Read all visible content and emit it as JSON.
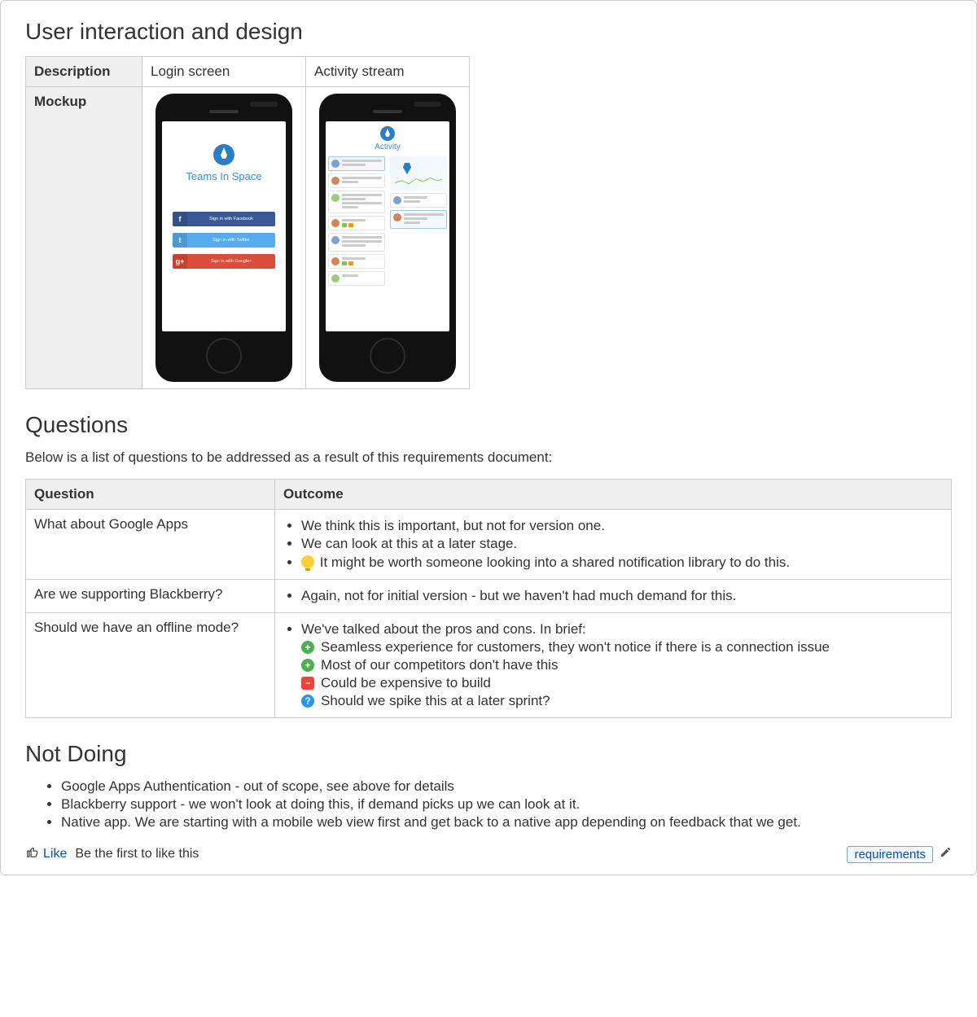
{
  "sections": {
    "design": {
      "heading": "User interaction and design",
      "row_labels": {
        "description": "Description",
        "mockup": "Mockup"
      },
      "columns": [
        {
          "title": "Login screen",
          "kind": "login"
        },
        {
          "title": "Activity stream",
          "kind": "activity"
        }
      ],
      "login_mock": {
        "app_name": "Teams In Space",
        "buttons": [
          {
            "provider": "facebook",
            "label": "Sign in with Facebook",
            "glyph": "f"
          },
          {
            "provider": "twitter",
            "label": "Sign in with Twitter",
            "glyph": "t"
          },
          {
            "provider": "google",
            "label": "Sign in with Google+",
            "glyph": "g+"
          }
        ]
      },
      "activity_mock": {
        "title": "Activity"
      }
    },
    "questions": {
      "heading": "Questions",
      "intro": "Below is a list of questions to be addressed as a result of this requirements document:",
      "columns": {
        "q": "Question",
        "o": "Outcome"
      },
      "rows": [
        {
          "q": "What about Google Apps",
          "outcomes": [
            {
              "text": "We think this is important, but not for version one."
            },
            {
              "text": "We can look at this at a later stage."
            },
            {
              "icon": "bulb",
              "text": "It might be worth someone looking into a shared notification library to do this."
            }
          ]
        },
        {
          "q": "Are we supporting Blackberry?",
          "outcomes": [
            {
              "text": "Again, not for initial version - but we haven't had much demand for this."
            }
          ]
        },
        {
          "q": "Should we have an offline mode?",
          "outcomes": [
            {
              "text": "We've talked about the pros and cons. In brief:",
              "sub": [
                {
                  "icon": "plus",
                  "text": "Seamless experience for customers, they won't notice if there is a connection issue"
                },
                {
                  "icon": "plus",
                  "text": "Most of our competitors don't have this"
                },
                {
                  "icon": "minus",
                  "text": "Could be expensive to build"
                },
                {
                  "icon": "qmark",
                  "text": "Should we spike this at a later sprint?"
                }
              ]
            }
          ]
        }
      ]
    },
    "not_doing": {
      "heading": "Not Doing",
      "items": [
        "Google Apps Authentication - out of scope, see above for details",
        "Blackberry support - we won't look at doing this, if demand picks up we can look at it.",
        "Native app. We are starting with a mobile web view first and get back to a native app depending on feedback that we get."
      ]
    }
  },
  "footer": {
    "like_label": "Like",
    "first_like_text": "Be the first to like this",
    "tag": "requirements"
  }
}
